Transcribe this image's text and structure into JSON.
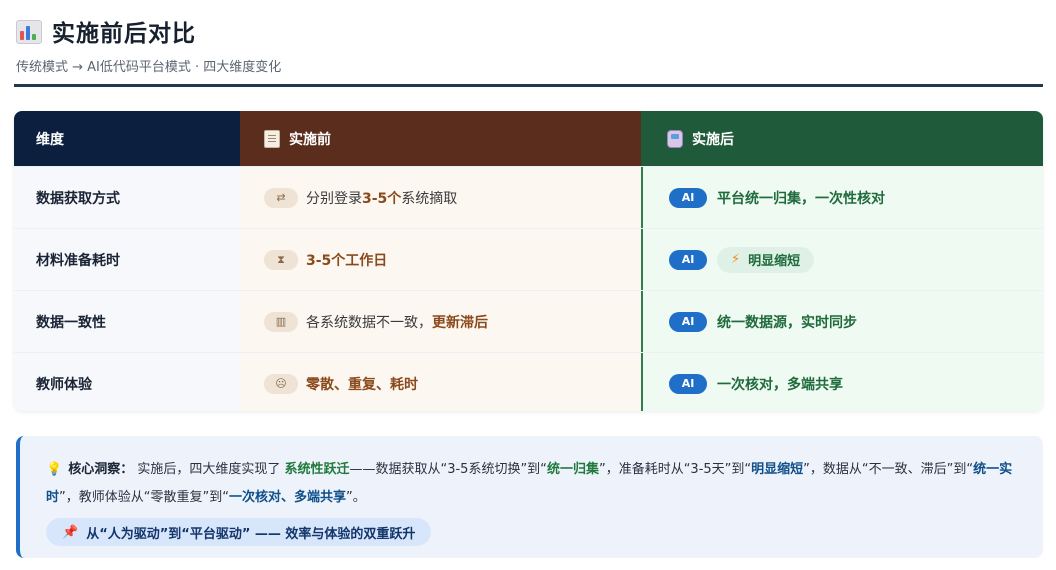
{
  "header": {
    "title": "实施前后对比",
    "subtitle": "传统模式 → AI低代码平台模式 · 四大维度变化",
    "icon": "bar-chart-icon"
  },
  "table": {
    "headers": {
      "dimension": "维度",
      "before": "实施前",
      "after": "实施后",
      "before_icon": "clipboard-icon",
      "after_icon": "train-icon"
    },
    "rows": [
      {
        "dimension": "数据获取方式",
        "before_icon": "shuffle-icon",
        "before_parts": [
          "分别登录 ",
          "3-5个",
          " 系统摘取"
        ],
        "after_badge": "AI",
        "after": "平台统一归集，一次性核对"
      },
      {
        "dimension": "材料准备耗时",
        "before_icon": "hourglass-icon",
        "before_parts": [
          "3-5个工作日"
        ],
        "after_badge": "AI",
        "after_icon": "lightning-icon",
        "after": "明显缩短"
      },
      {
        "dimension": "数据一致性",
        "before_icon": "bar-chart-icon",
        "before_parts": [
          "各系统数据不一致，",
          "更新滞后"
        ],
        "after_badge": "AI",
        "after": "统一数据源，实时同步"
      },
      {
        "dimension": "教师体验",
        "before_icon": "tired-face-icon",
        "before_parts": [
          "零散、重复、耗时"
        ],
        "after_badge": "AI",
        "after": "一次核对，多端共享"
      }
    ]
  },
  "insight": {
    "icon": "lightbulb-icon",
    "label": "核心洞察：",
    "parts": [
      " 实施后，四大维度实现了 ",
      "系统性跃迁",
      "——数据获取从“3-5系统切换”到“",
      "统一归集",
      "”，准备耗时从“3-5天”到“",
      "明显缩短",
      "”，数据从“不一致、滞后”到“",
      "统一实时",
      "”，教师体验从“零散重复”到“",
      "一次核对、多端共享",
      "”。"
    ],
    "tagline_icon": "pushpin-icon",
    "tagline": "从“人为驱动”到“平台驱动” —— 效率与体验的双重跃升"
  }
}
